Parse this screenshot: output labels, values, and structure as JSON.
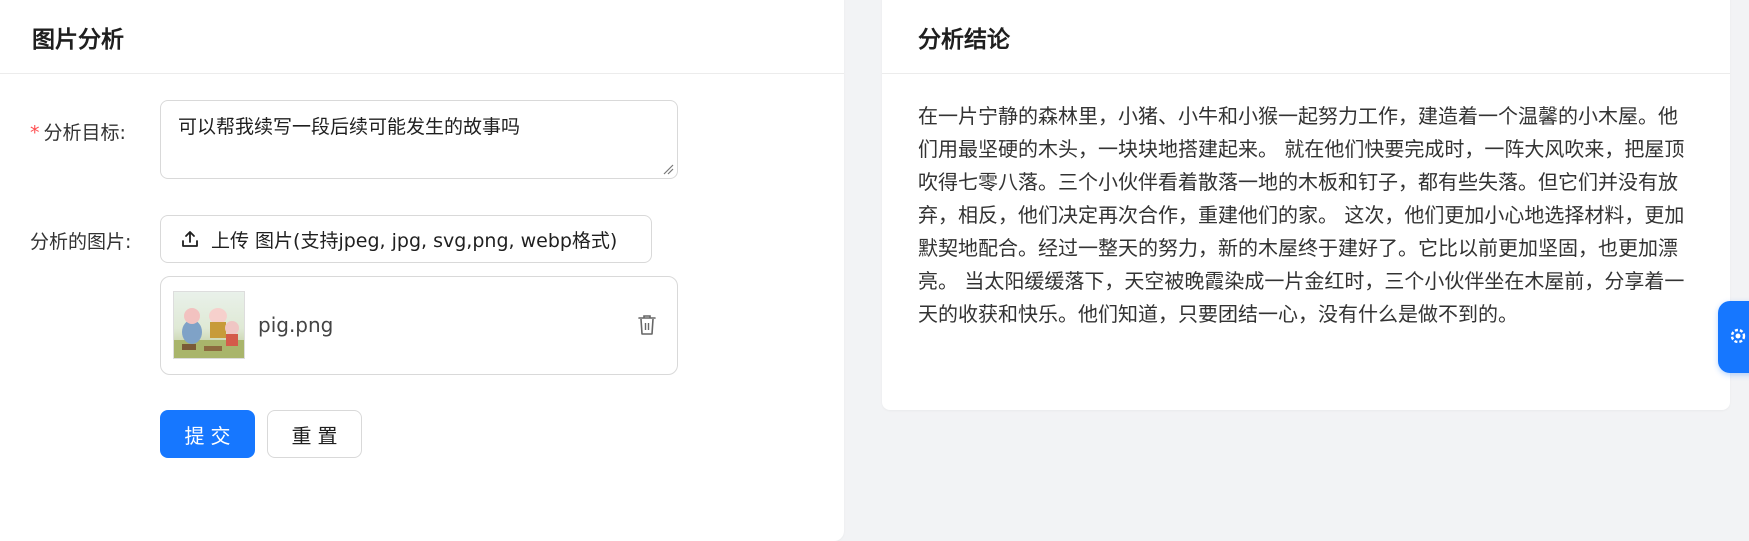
{
  "left_panel": {
    "title": "图片分析",
    "target_label": "分析目标:",
    "required_mark": "*",
    "target_value": "可以帮我续写一段后续可能发生的故事吗",
    "image_label": "分析的图片:",
    "upload_label": "上传 图片(支持jpeg, jpg, svg,png, webp格式)",
    "file": {
      "name": "pig.png"
    },
    "submit_label": "提交",
    "reset_label": "重置"
  },
  "right_panel": {
    "title": "分析结论",
    "text": "在一片宁静的森林里，小猪、小牛和小猴一起努力工作，建造着一个温馨的小木屋。他们用最坚硬的木头，一块块地搭建起来。 就在他们快要完成时，一阵大风吹来，把屋顶吹得七零八落。三个小伙伴看着散落一地的木板和钉子，都有些失落。但它们并没有放弃，相反，他们决定再次合作，重建他们的家。 这次，他们更加小心地选择材料，更加默契地配合。经过一整天的努力，新的木屋终于建好了。它比以前更加坚固，也更加漂亮。 当太阳缓缓落下，天空被晚霞染成一片金红时，三个小伙伴坐在木屋前，分享着一天的收获和快乐。他们知道，只要团结一心，没有什么是做不到的。"
  },
  "colors": {
    "primary": "#1677ff",
    "required": "#ff4d4f",
    "background": "#f2f3f5"
  },
  "icons": [
    "upload-icon",
    "delete-icon",
    "settings-icon"
  ]
}
